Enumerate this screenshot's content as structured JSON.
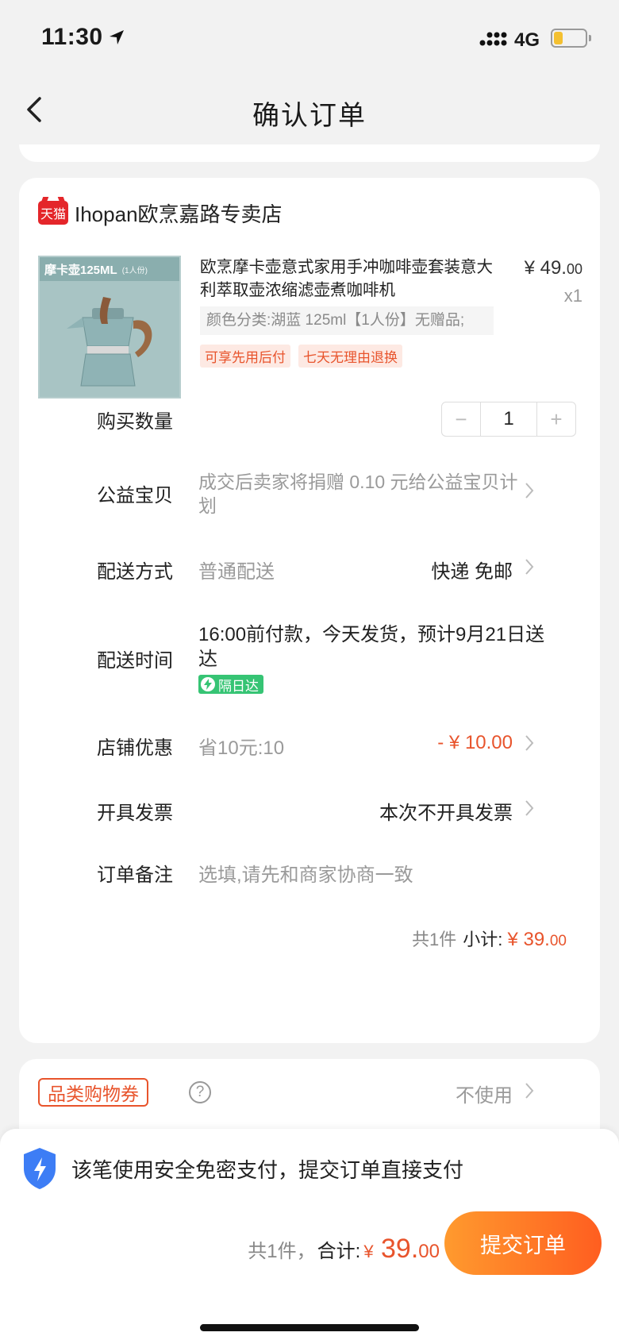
{
  "status_bar": {
    "time": "11:30",
    "network": "4G",
    "battery_color": "#f4c030"
  },
  "nav": {
    "title": "确认订单"
  },
  "shop": {
    "badge": "天猫",
    "name": "Ihopan欧烹嘉路专卖店"
  },
  "product": {
    "image_label": "摩卡壶125ML",
    "image_label_sub": "(1人份)",
    "title": "欧烹摩卡壶意式家用手冲咖啡壶套装意大利萃取壶浓缩滤壶煮咖啡机",
    "sku": "颜色分类:湖蓝 125ml【1人份】无赠品;",
    "price_main": "¥ 49.",
    "price_cents": "00",
    "qty": "x1",
    "tags": [
      "可享先用后付",
      "七天无理由退换"
    ]
  },
  "rows": {
    "quantity": {
      "label": "购买数量",
      "value": "1",
      "minus": "−",
      "plus": "+"
    },
    "charity": {
      "label": "公益宝贝",
      "value": "成交后卖家将捐赠 0.10 元给公益宝贝计划"
    },
    "shipping": {
      "label": "配送方式",
      "value": "普通配送",
      "right": "快递 免邮"
    },
    "delivery_time": {
      "label": "配送时间",
      "value": "16:00前付款，今天发货，预计9月21日送达",
      "badge": "隔日达"
    },
    "shop_discount": {
      "label": "店铺优惠",
      "value": "省10元:10",
      "right": "- ¥ 10.00"
    },
    "invoice": {
      "label": "开具发票",
      "right": "本次不开具发票"
    },
    "note": {
      "label": "订单备注",
      "placeholder": "选填,请先和商家协商一致"
    }
  },
  "subtotal": {
    "count": "共1件",
    "label": "小计:",
    "amount_main": "¥ 39.",
    "amount_cents": "00"
  },
  "coupon": {
    "tag": "品类购物券",
    "help": "?",
    "value": "不使用"
  },
  "bottom": {
    "secure_text": "该笔使用安全免密支付，提交订单直接支付",
    "count": "共1件，",
    "total_label": "合计:",
    "currency": "¥",
    "total_main": " 39.",
    "total_cents": "00",
    "submit": "提交订单"
  },
  "colors": {
    "accent": "#e8542c",
    "tmall_red": "#e4262a",
    "nextday_green": "#36c474"
  }
}
